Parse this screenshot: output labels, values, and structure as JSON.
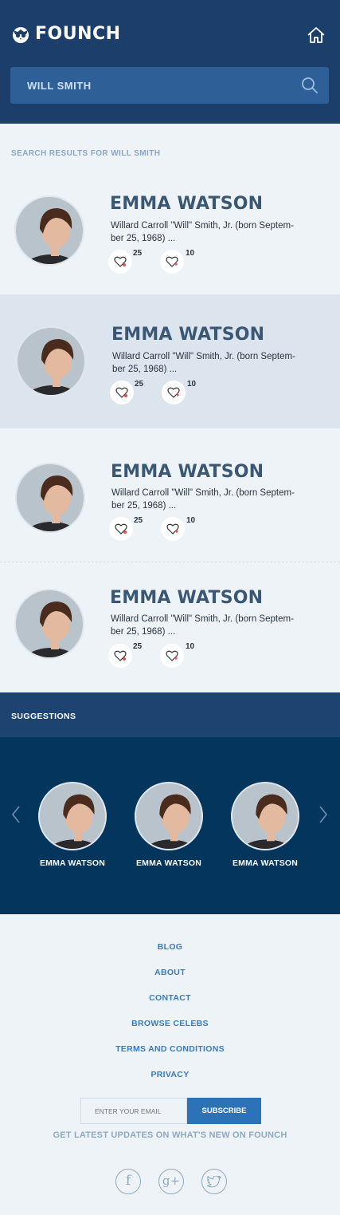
{
  "brand": {
    "name": "FOUNCH"
  },
  "search": {
    "value": "WILL SMITH"
  },
  "results": {
    "title": "SEARCH RESULTS FOR WILL SMITH",
    "items": [
      {
        "name": "EMMA WATSON",
        "desc_line1": "Willard Carroll \"Will\" Smith, Jr. (born Septem-",
        "desc_line2": "ber 25, 1968) ...",
        "likes": "25",
        "hearts": "10"
      },
      {
        "name": "EMMA WATSON",
        "desc_line1": "Willard Carroll \"Will\" Smith, Jr. (born Septem-",
        "desc_line2": "ber 25, 1968) ...",
        "likes": "25",
        "hearts": "10"
      },
      {
        "name": "EMMA WATSON",
        "desc_line1": "Willard Carroll \"Will\" Smith, Jr. (born Septem-",
        "desc_line2": "ber 25, 1968) ...",
        "likes": "25",
        "hearts": "10"
      },
      {
        "name": "EMMA WATSON",
        "desc_line1": "Willard Carroll \"Will\" Smith, Jr. (born Septem-",
        "desc_line2": "ber 25, 1968) ...",
        "likes": "25",
        "hearts": "10"
      }
    ]
  },
  "suggestions": {
    "title": "SUGGESTIONS",
    "items": [
      {
        "name": "EMMA WATSON"
      },
      {
        "name": "EMMA WATSON"
      },
      {
        "name": "EMMA WATSON"
      }
    ]
  },
  "footer": {
    "links": [
      "BLOG",
      "ABOUT",
      "CONTACT",
      "BROWSE CELEBS",
      "TERMS AND CONDITIONS",
      "PRIVACY"
    ],
    "email_placeholder": "ENTER YOUR EMAIL",
    "subscribe_label": "SUBSCRIBE",
    "updates_text": "GET LATEST UPDATES ON WHAT'S NEW ON FOUNCH",
    "social": {
      "facebook": "f",
      "google": "g+"
    }
  },
  "colors": {
    "header": "#1b3f6a",
    "search_bg": "#2e6097",
    "highlight_row": "#dce5ee",
    "suggestions_head": "#1d4470",
    "suggestions_body": "#04355d",
    "link": "#3a7bbd",
    "subscribe": "#2b72b6"
  },
  "icons": {
    "logo": "owl-logo-icon",
    "home": "home-icon",
    "search": "search-icon",
    "like": "heart-icon",
    "heart_count": "heart-add-icon",
    "prev": "chevron-left-icon",
    "next": "chevron-right-icon",
    "twitter": "twitter-icon"
  }
}
